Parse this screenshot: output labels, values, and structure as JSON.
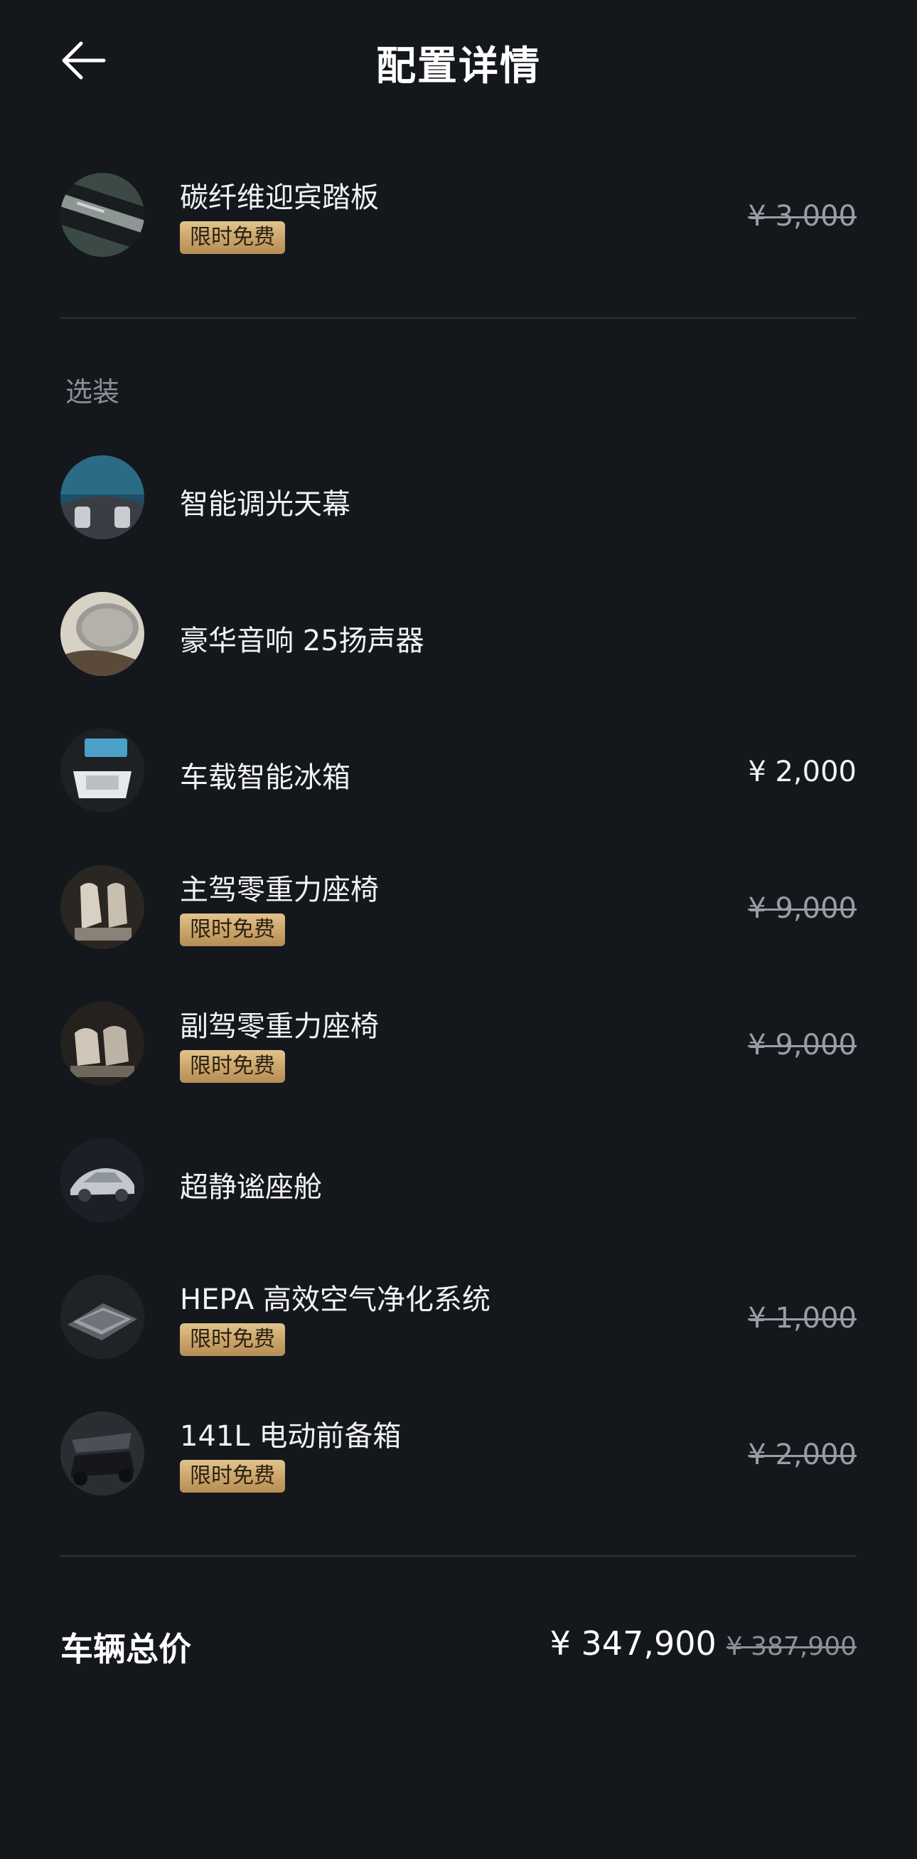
{
  "header": {
    "title": "配置详情",
    "back_icon": "arrow-left-icon"
  },
  "standard_items": [
    {
      "name": "碳纤维迎宾踏板",
      "badge": "限时免费",
      "price": "¥ 3,000",
      "price_struck": true
    }
  ],
  "optional_section": {
    "label": "选装",
    "items": [
      {
        "name": "智能调光天幕"
      },
      {
        "name": "豪华音响 25扬声器"
      },
      {
        "name": "车载智能冰箱",
        "price": "¥ 2,000"
      },
      {
        "name": "主驾零重力座椅",
        "badge": "限时免费",
        "price": "¥ 9,000",
        "price_struck": true
      },
      {
        "name": "副驾零重力座椅",
        "badge": "限时免费",
        "price": "¥ 9,000",
        "price_struck": true
      },
      {
        "name": "超静谧座舱"
      },
      {
        "name": "HEPA 高效空气净化系统",
        "badge": "限时免费",
        "price": "¥ 1,000",
        "price_struck": true
      },
      {
        "name": "141L 电动前备箱",
        "badge": "限时免费",
        "price": "¥ 2,000",
        "price_struck": true
      }
    ]
  },
  "total": {
    "label": "车辆总价",
    "price": "¥ 347,900",
    "original_price": "¥ 387,900"
  },
  "colors": {
    "background": "#14171c",
    "badge_gold": "#c9a36a",
    "divider": "#2e3238",
    "muted": "#8d9096"
  }
}
